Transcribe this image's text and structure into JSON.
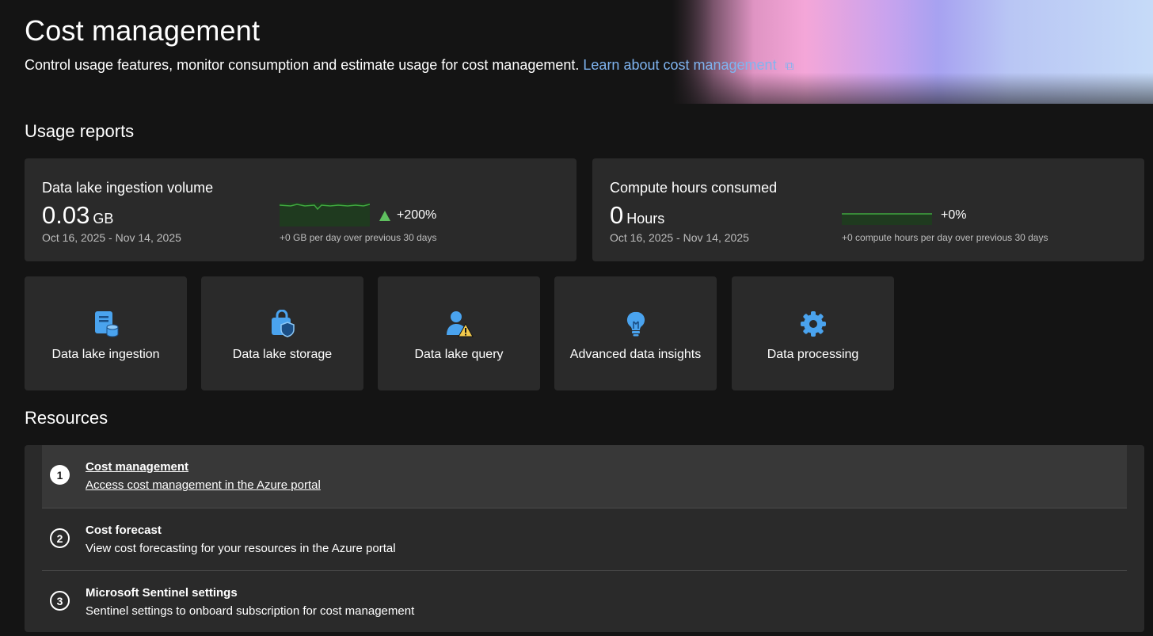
{
  "header": {
    "title": "Cost management",
    "subtitle": "Control usage features, monitor consumption and estimate usage for cost management.",
    "learn_link": "Learn about cost management"
  },
  "usage_reports": {
    "heading": "Usage reports",
    "cards": [
      {
        "title": "Data lake ingestion volume",
        "value": "0.03",
        "unit": "GB",
        "date_range": "Oct 16, 2025 - Nov 14, 2025",
        "delta": "+200%",
        "trend": "up",
        "footnote": "+0 GB per day over previous 30 days"
      },
      {
        "title": "Compute hours consumed",
        "value": "0",
        "unit": "Hours",
        "date_range": "Oct 16, 2025 - Nov 14, 2025",
        "delta": "+0%",
        "trend": "flat",
        "footnote": "+0 compute hours per day over previous 30 days"
      }
    ]
  },
  "tiles": [
    {
      "label": "Data lake ingestion",
      "icon": "database-document-icon"
    },
    {
      "label": "Data lake storage",
      "icon": "shield-lock-bag-icon"
    },
    {
      "label": "Data lake query",
      "icon": "person-warning-icon"
    },
    {
      "label": "Advanced data insights",
      "icon": "lightbulb-icon"
    },
    {
      "label": "Data processing",
      "icon": "gear-icon"
    }
  ],
  "resources": {
    "heading": "Resources",
    "items": [
      {
        "number": "1",
        "title": "Cost management",
        "description": "Access cost management in the Azure portal"
      },
      {
        "number": "2",
        "title": "Cost forecast",
        "description": "View cost forecasting for your resources in the Azure portal"
      },
      {
        "number": "3",
        "title": "Microsoft Sentinel settings",
        "description": "Sentinel settings to onboard subscription for cost management"
      }
    ]
  },
  "colors": {
    "background": "#141414",
    "card": "#2a2a2a",
    "link": "#7fb4f0",
    "icon_blue": "#4aa3ee",
    "trend_green": "#5fbf5f"
  }
}
